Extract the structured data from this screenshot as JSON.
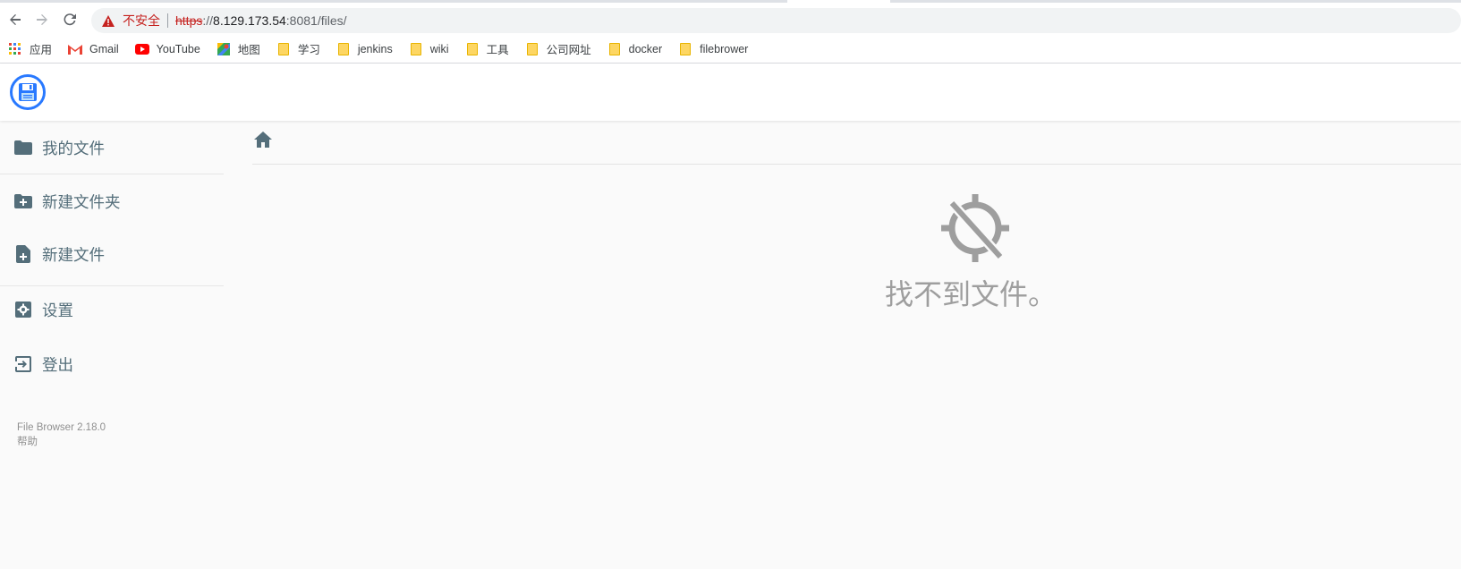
{
  "browser": {
    "security_label": "不安全",
    "url_protocol": "https",
    "url_sep": "://",
    "url_host": "8.129.173.54",
    "url_rest": ":8081/files/",
    "bookmarks": [
      {
        "label": "应用",
        "icon": "apps-grid-icon"
      },
      {
        "label": "Gmail",
        "icon": "gmail-icon"
      },
      {
        "label": "YouTube",
        "icon": "youtube-icon"
      },
      {
        "label": "地图",
        "icon": "maps-icon"
      },
      {
        "label": "学习",
        "icon": "folder-icon"
      },
      {
        "label": "jenkins",
        "icon": "folder-icon"
      },
      {
        "label": "wiki",
        "icon": "folder-icon"
      },
      {
        "label": "工具",
        "icon": "folder-icon"
      },
      {
        "label": "公司网址",
        "icon": "folder-icon"
      },
      {
        "label": "docker",
        "icon": "folder-icon"
      },
      {
        "label": "filebrower",
        "icon": "folder-icon"
      }
    ]
  },
  "sidebar": {
    "items": [
      {
        "label": "我的文件",
        "icon": "folder-icon"
      },
      {
        "label": "新建文件夹",
        "icon": "new-folder-icon"
      },
      {
        "label": "新建文件",
        "icon": "new-file-icon"
      },
      {
        "label": "设置",
        "icon": "settings-icon"
      },
      {
        "label": "登出",
        "icon": "logout-icon"
      }
    ],
    "version": "File Browser 2.18.0",
    "help": "帮助"
  },
  "main": {
    "empty_message": "找不到文件。",
    "empty_icon": "gps-off-icon"
  },
  "colors": {
    "accent": "#2979ff",
    "sidebar_text": "#546e7a",
    "insecure": "#c5221f"
  }
}
